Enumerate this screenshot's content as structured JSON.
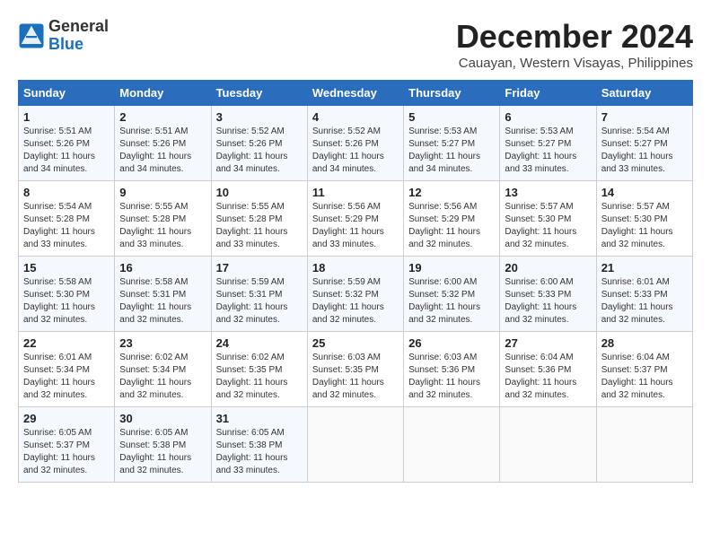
{
  "header": {
    "logo_general": "General",
    "logo_blue": "Blue",
    "month_title": "December 2024",
    "location": "Cauayan, Western Visayas, Philippines"
  },
  "calendar": {
    "days_of_week": [
      "Sunday",
      "Monday",
      "Tuesday",
      "Wednesday",
      "Thursday",
      "Friday",
      "Saturday"
    ],
    "weeks": [
      [
        {
          "day": "1",
          "info": "Sunrise: 5:51 AM\nSunset: 5:26 PM\nDaylight: 11 hours\nand 34 minutes."
        },
        {
          "day": "2",
          "info": "Sunrise: 5:51 AM\nSunset: 5:26 PM\nDaylight: 11 hours\nand 34 minutes."
        },
        {
          "day": "3",
          "info": "Sunrise: 5:52 AM\nSunset: 5:26 PM\nDaylight: 11 hours\nand 34 minutes."
        },
        {
          "day": "4",
          "info": "Sunrise: 5:52 AM\nSunset: 5:26 PM\nDaylight: 11 hours\nand 34 minutes."
        },
        {
          "day": "5",
          "info": "Sunrise: 5:53 AM\nSunset: 5:27 PM\nDaylight: 11 hours\nand 34 minutes."
        },
        {
          "day": "6",
          "info": "Sunrise: 5:53 AM\nSunset: 5:27 PM\nDaylight: 11 hours\nand 33 minutes."
        },
        {
          "day": "7",
          "info": "Sunrise: 5:54 AM\nSunset: 5:27 PM\nDaylight: 11 hours\nand 33 minutes."
        }
      ],
      [
        {
          "day": "8",
          "info": "Sunrise: 5:54 AM\nSunset: 5:28 PM\nDaylight: 11 hours\nand 33 minutes."
        },
        {
          "day": "9",
          "info": "Sunrise: 5:55 AM\nSunset: 5:28 PM\nDaylight: 11 hours\nand 33 minutes."
        },
        {
          "day": "10",
          "info": "Sunrise: 5:55 AM\nSunset: 5:28 PM\nDaylight: 11 hours\nand 33 minutes."
        },
        {
          "day": "11",
          "info": "Sunrise: 5:56 AM\nSunset: 5:29 PM\nDaylight: 11 hours\nand 33 minutes."
        },
        {
          "day": "12",
          "info": "Sunrise: 5:56 AM\nSunset: 5:29 PM\nDaylight: 11 hours\nand 32 minutes."
        },
        {
          "day": "13",
          "info": "Sunrise: 5:57 AM\nSunset: 5:30 PM\nDaylight: 11 hours\nand 32 minutes."
        },
        {
          "day": "14",
          "info": "Sunrise: 5:57 AM\nSunset: 5:30 PM\nDaylight: 11 hours\nand 32 minutes."
        }
      ],
      [
        {
          "day": "15",
          "info": "Sunrise: 5:58 AM\nSunset: 5:30 PM\nDaylight: 11 hours\nand 32 minutes."
        },
        {
          "day": "16",
          "info": "Sunrise: 5:58 AM\nSunset: 5:31 PM\nDaylight: 11 hours\nand 32 minutes."
        },
        {
          "day": "17",
          "info": "Sunrise: 5:59 AM\nSunset: 5:31 PM\nDaylight: 11 hours\nand 32 minutes."
        },
        {
          "day": "18",
          "info": "Sunrise: 5:59 AM\nSunset: 5:32 PM\nDaylight: 11 hours\nand 32 minutes."
        },
        {
          "day": "19",
          "info": "Sunrise: 6:00 AM\nSunset: 5:32 PM\nDaylight: 11 hours\nand 32 minutes."
        },
        {
          "day": "20",
          "info": "Sunrise: 6:00 AM\nSunset: 5:33 PM\nDaylight: 11 hours\nand 32 minutes."
        },
        {
          "day": "21",
          "info": "Sunrise: 6:01 AM\nSunset: 5:33 PM\nDaylight: 11 hours\nand 32 minutes."
        }
      ],
      [
        {
          "day": "22",
          "info": "Sunrise: 6:01 AM\nSunset: 5:34 PM\nDaylight: 11 hours\nand 32 minutes."
        },
        {
          "day": "23",
          "info": "Sunrise: 6:02 AM\nSunset: 5:34 PM\nDaylight: 11 hours\nand 32 minutes."
        },
        {
          "day": "24",
          "info": "Sunrise: 6:02 AM\nSunset: 5:35 PM\nDaylight: 11 hours\nand 32 minutes."
        },
        {
          "day": "25",
          "info": "Sunrise: 6:03 AM\nSunset: 5:35 PM\nDaylight: 11 hours\nand 32 minutes."
        },
        {
          "day": "26",
          "info": "Sunrise: 6:03 AM\nSunset: 5:36 PM\nDaylight: 11 hours\nand 32 minutes."
        },
        {
          "day": "27",
          "info": "Sunrise: 6:04 AM\nSunset: 5:36 PM\nDaylight: 11 hours\nand 32 minutes."
        },
        {
          "day": "28",
          "info": "Sunrise: 6:04 AM\nSunset: 5:37 PM\nDaylight: 11 hours\nand 32 minutes."
        }
      ],
      [
        {
          "day": "29",
          "info": "Sunrise: 6:05 AM\nSunset: 5:37 PM\nDaylight: 11 hours\nand 32 minutes."
        },
        {
          "day": "30",
          "info": "Sunrise: 6:05 AM\nSunset: 5:38 PM\nDaylight: 11 hours\nand 32 minutes."
        },
        {
          "day": "31",
          "info": "Sunrise: 6:05 AM\nSunset: 5:38 PM\nDaylight: 11 hours\nand 33 minutes."
        },
        null,
        null,
        null,
        null
      ]
    ]
  }
}
